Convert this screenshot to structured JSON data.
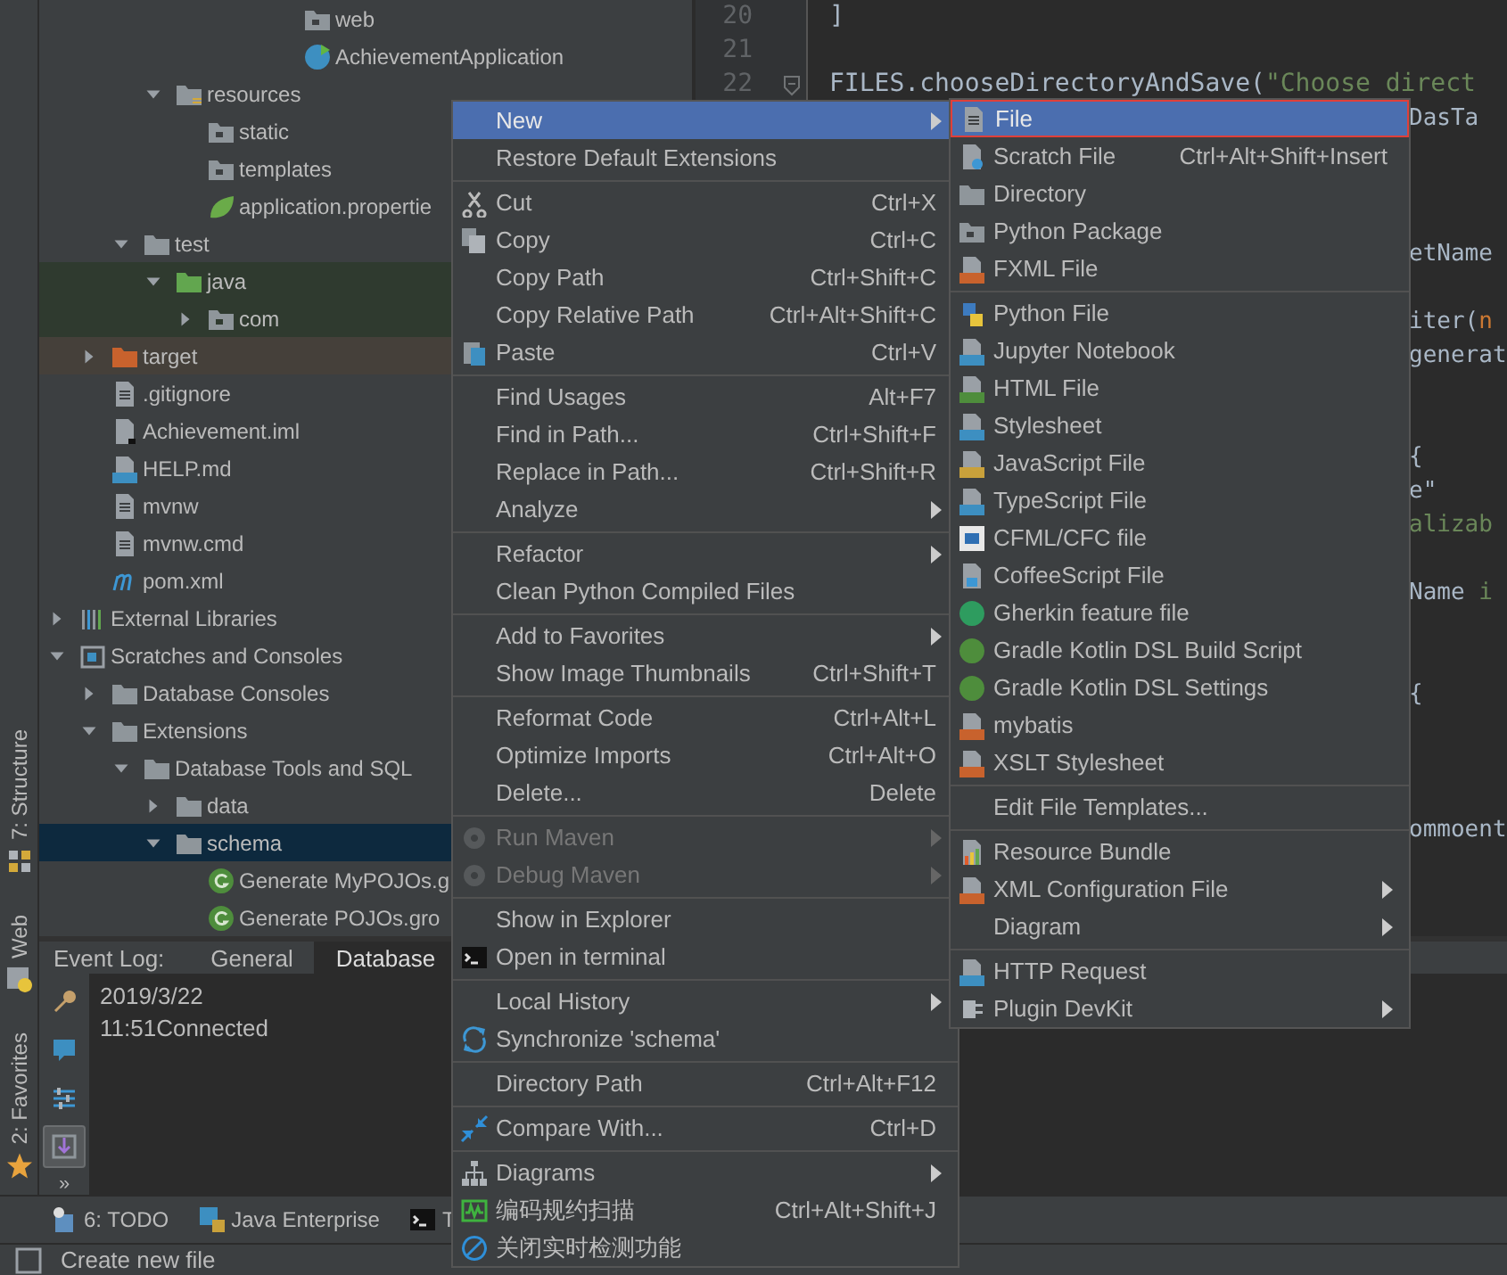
{
  "side_strip": {
    "tabs": [
      {
        "label": "7: Structure",
        "kind": "structure"
      },
      {
        "label": "Web",
        "kind": "web"
      },
      {
        "label": "2: Favorites",
        "kind": "star"
      }
    ]
  },
  "project_tree": {
    "items": [
      {
        "children": [
          {
            "children": [
              {
                "children": [
                  {
                    "children": [
                      {
                        "children": [
                          {
                            "children": [
                              {
                                "children": [
                                  {
                                    "label": "web",
                                    "kind": "package",
                                    "selected": false
                                  },
                                  {
                                    "label": "AchievementApplication",
                                    "kind": "spring-class",
                                    "selected": false
                                  }
                                ]
                              }
                            ]
                          }
                        ]
                      }
                    ]
                  },
                  {
                    "label": "resources",
                    "kind": "resource-folder",
                    "expanded": true,
                    "selected": false,
                    "children": [
                      {
                        "label": "static",
                        "kind": "package",
                        "selected": false
                      },
                      {
                        "label": "templates",
                        "kind": "package",
                        "selected": false
                      },
                      {
                        "label": "application.propertie",
                        "kind": "spring",
                        "selected": false
                      }
                    ]
                  }
                ]
              },
              {
                "label": "test",
                "kind": "folder",
                "expanded": true,
                "selected": false,
                "children": [
                  {
                    "label": "java",
                    "kind": "test-folder",
                    "expanded": true,
                    "selected": false,
                    "children": [
                      {
                        "label": "com",
                        "kind": "test-package",
                        "expanded": false,
                        "selected": false
                      }
                    ]
                  }
                ]
              }
            ]
          },
          {
            "label": "target",
            "kind": "excluded-folder",
            "expanded": false,
            "selected": false
          },
          {
            "label": ".gitignore",
            "kind": "text-file",
            "selected": false
          },
          {
            "label": "Achievement.iml",
            "kind": "iml",
            "selected": false
          },
          {
            "label": "HELP.md",
            "kind": "md",
            "selected": false
          },
          {
            "label": "mvnw",
            "kind": "text-file",
            "selected": false
          },
          {
            "label": "mvnw.cmd",
            "kind": "text-file",
            "selected": false
          },
          {
            "label": "pom.xml",
            "kind": "maven",
            "selected": false
          }
        ]
      },
      {
        "label": "External Libraries",
        "kind": "libraries",
        "expanded": false,
        "selected": false
      },
      {
        "label": "Scratches and Consoles",
        "kind": "scratches",
        "expanded": true,
        "selected": false,
        "children": [
          {
            "label": "Database Consoles",
            "kind": "folder",
            "expanded": false,
            "selected": false
          },
          {
            "label": "Extensions",
            "kind": "folder",
            "expanded": true,
            "selected": false,
            "children": [
              {
                "label": "Database Tools and SQL",
                "kind": "folder",
                "expanded": true,
                "selected": false,
                "children": [
                  {
                    "label": "data",
                    "kind": "folder",
                    "expanded": false,
                    "selected": false
                  },
                  {
                    "label": "schema",
                    "kind": "folder",
                    "expanded": true,
                    "selected": true,
                    "children": [
                      {
                        "label": "Generate MyPOJOs.g",
                        "kind": "groovy",
                        "selected": false
                      },
                      {
                        "label": "Generate POJOs.gro",
                        "kind": "groovy",
                        "selected": false
                      }
                    ]
                  }
                ]
              }
            ]
          }
        ]
      }
    ]
  },
  "editor": {
    "lines": [
      {
        "number": "20",
        "fold": false,
        "segments": [
          {
            "text": "]",
            "kind": "plain"
          }
        ]
      },
      {
        "number": "21",
        "fold": false
      },
      {
        "number": "22",
        "fold": true,
        "segments": [
          {
            "text": "FILES.chooseDirectoryAndSave(",
            "kind": "plain"
          },
          {
            "text": "\"Choose direct",
            "kind": "string"
          }
        ]
      }
    ],
    "peek": [
      {
        "segments": [
          {
            "text": "DasTa",
            "kind": "plain"
          }
        ]
      },
      {
        "segments": [
          {
            "text": "etName",
            "kind": "plain"
          }
        ]
      },
      {
        "segments": [
          {
            "text": "iter(",
            "kind": "plain"
          },
          {
            "text": "n",
            "kind": "keyword"
          }
        ]
      },
      {
        "segments": [
          {
            "text": "generat",
            "kind": "plain"
          }
        ]
      },
      {
        "segments": [
          {
            "text": "{",
            "kind": "plain"
          }
        ]
      },
      {
        "segments": [
          {
            "text": "e\"",
            "kind": "plain"
          }
        ]
      },
      {
        "segments": [
          {
            "text": "alizab",
            "kind": "string"
          }
        ]
      },
      {
        "segments": [
          {
            "text": "Name ",
            "kind": "plain"
          },
          {
            "text": "i",
            "kind": "string"
          }
        ]
      },
      {
        "segments": [
          {
            "text": "{",
            "kind": "plain"
          }
        ]
      },
      {
        "segments": [
          {
            "text": "ommoent",
            "kind": "plain"
          }
        ]
      }
    ]
  },
  "event_log": {
    "title": "Event Log:",
    "tabs": [
      {
        "label": "General",
        "selected": false
      },
      {
        "label": "Database",
        "selected": true
      }
    ],
    "tools": [
      {
        "kind": "wrench",
        "on": false
      },
      {
        "kind": "balloon",
        "on": false
      },
      {
        "kind": "sliders",
        "on": false
      },
      {
        "kind": "scroll",
        "on": true
      }
    ],
    "more": "»",
    "entries": [
      {
        "date": "2019/3/22",
        "time": "11:51",
        "message": "Connected"
      }
    ]
  },
  "bottom_toolbar": [
    {
      "label": "6: TODO",
      "kind": "todo"
    },
    {
      "label": "Java Enterprise",
      "kind": "java-ee"
    },
    {
      "label": "T",
      "kind": "terminal"
    }
  ],
  "status_bar": {
    "text": "Create new file"
  },
  "context_menu": {
    "groups": [
      [
        {
          "label": "New",
          "kind": "plain",
          "submenu": true,
          "selected": true,
          "disabled": false
        },
        {
          "label": "Restore Default Extensions",
          "kind": "plain",
          "submenu": false,
          "selected": false,
          "disabled": false
        }
      ],
      [
        {
          "label": "Cut",
          "kind": "scissors",
          "shortcut": "Ctrl+X",
          "submenu": false,
          "selected": false,
          "disabled": false
        },
        {
          "label": "Copy",
          "kind": "copy",
          "shortcut": "Ctrl+C",
          "submenu": false,
          "selected": false,
          "disabled": false
        },
        {
          "label": "Copy Path",
          "kind": "plain",
          "shortcut": "Ctrl+Shift+C",
          "submenu": false,
          "selected": false,
          "disabled": false
        },
        {
          "label": "Copy Relative Path",
          "kind": "plain",
          "shortcut": "Ctrl+Alt+Shift+C",
          "submenu": false,
          "selected": false,
          "disabled": false
        },
        {
          "label": "Paste",
          "kind": "paste",
          "shortcut": "Ctrl+V",
          "submenu": false,
          "selected": false,
          "disabled": false
        }
      ],
      [
        {
          "label": "Find Usages",
          "kind": "plain",
          "shortcut": "Alt+F7",
          "submenu": false,
          "selected": false,
          "disabled": false
        },
        {
          "label": "Find in Path...",
          "kind": "plain",
          "shortcut": "Ctrl+Shift+F",
          "submenu": false,
          "selected": false,
          "disabled": false
        },
        {
          "label": "Replace in Path...",
          "kind": "plain",
          "shortcut": "Ctrl+Shift+R",
          "submenu": false,
          "selected": false,
          "disabled": false
        },
        {
          "label": "Analyze",
          "kind": "plain",
          "submenu": true,
          "selected": false,
          "disabled": false
        }
      ],
      [
        {
          "label": "Refactor",
          "kind": "plain",
          "submenu": true,
          "selected": false,
          "disabled": false
        },
        {
          "label": "Clean Python Compiled Files",
          "kind": "plain",
          "submenu": false,
          "selected": false,
          "disabled": false
        }
      ],
      [
        {
          "label": "Add to Favorites",
          "kind": "plain",
          "submenu": true,
          "selected": false,
          "disabled": false
        },
        {
          "label": "Show Image Thumbnails",
          "kind": "plain",
          "shortcut": "Ctrl+Shift+T",
          "submenu": false,
          "selected": false,
          "disabled": false
        }
      ],
      [
        {
          "label": "Reformat Code",
          "kind": "plain",
          "shortcut": "Ctrl+Alt+L",
          "submenu": false,
          "selected": false,
          "disabled": false
        },
        {
          "label": "Optimize Imports",
          "kind": "plain",
          "shortcut": "Ctrl+Alt+O",
          "submenu": false,
          "selected": false,
          "disabled": false
        },
        {
          "label": "Delete...",
          "kind": "plain",
          "shortcut": "Delete",
          "submenu": false,
          "selected": false,
          "disabled": false
        }
      ],
      [
        {
          "label": "Run Maven",
          "kind": "gear",
          "submenu": true,
          "selected": false,
          "disabled": true
        },
        {
          "label": "Debug Maven",
          "kind": "gear",
          "submenu": true,
          "selected": false,
          "disabled": true
        }
      ],
      [
        {
          "label": "Show in Explorer",
          "kind": "plain",
          "submenu": false,
          "selected": false,
          "disabled": false
        },
        {
          "label": "Open in terminal",
          "kind": "terminal",
          "submenu": false,
          "selected": false,
          "disabled": false
        }
      ],
      [
        {
          "label": "Local History",
          "kind": "plain",
          "submenu": true,
          "selected": false,
          "disabled": false
        },
        {
          "label": "Synchronize 'schema'",
          "kind": "sync",
          "submenu": false,
          "selected": false,
          "disabled": false
        }
      ],
      [
        {
          "label": "Directory Path",
          "kind": "plain",
          "shortcut": "Ctrl+Alt+F12",
          "submenu": false,
          "selected": false,
          "disabled": false
        }
      ],
      [
        {
          "label": "Compare With...",
          "kind": "compare",
          "shortcut": "Ctrl+D",
          "submenu": false,
          "selected": false,
          "disabled": false
        }
      ],
      [
        {
          "label": "Diagrams",
          "kind": "diagram",
          "submenu": true,
          "selected": false,
          "disabled": false
        },
        {
          "label": "编码规约扫描",
          "kind": "pulse",
          "shortcut": "Ctrl+Alt+Shift+J",
          "submenu": false,
          "selected": false,
          "disabled": false
        },
        {
          "label": "关闭实时检测功能",
          "kind": "forbid",
          "submenu": false,
          "selected": false,
          "disabled": false
        }
      ]
    ]
  },
  "new_submenu": {
    "groups": [
      [
        {
          "label": "File",
          "kind": "text-file",
          "submenu": false,
          "selected": true,
          "outlined": true
        },
        {
          "label": "Scratch File",
          "kind": "scratch-file",
          "shortcut": "Ctrl+Alt+Shift+Insert",
          "submenu": false,
          "selected": false,
          "outlined": false
        },
        {
          "label": "Directory",
          "kind": "folder",
          "submenu": false,
          "selected": false,
          "outlined": false
        },
        {
          "label": "Python Package",
          "kind": "package",
          "submenu": false,
          "selected": false,
          "outlined": false
        },
        {
          "label": "FXML File",
          "kind": "xml",
          "submenu": false,
          "selected": false,
          "outlined": false
        }
      ],
      [
        {
          "label": "Python File",
          "kind": "python",
          "submenu": false,
          "selected": false,
          "outlined": false
        },
        {
          "label": "Jupyter Notebook",
          "kind": "jupyter",
          "submenu": false,
          "selected": false,
          "outlined": false
        },
        {
          "label": "HTML File",
          "kind": "html",
          "submenu": false,
          "selected": false,
          "outlined": false
        },
        {
          "label": "Stylesheet",
          "kind": "css",
          "submenu": false,
          "selected": false,
          "outlined": false
        },
        {
          "label": "JavaScript File",
          "kind": "js",
          "submenu": false,
          "selected": false,
          "outlined": false
        },
        {
          "label": "TypeScript File",
          "kind": "ts",
          "submenu": false,
          "selected": false,
          "outlined": false
        },
        {
          "label": "CFML/CFC file",
          "kind": "cf",
          "submenu": false,
          "selected": false,
          "outlined": false
        },
        {
          "label": "CoffeeScript File",
          "kind": "coffee",
          "submenu": false,
          "selected": false,
          "outlined": false
        },
        {
          "label": "Gherkin feature file",
          "kind": "gherkin",
          "submenu": false,
          "selected": false,
          "outlined": false
        },
        {
          "label": "Gradle Kotlin DSL Build Script",
          "kind": "gradle",
          "submenu": false,
          "selected": false,
          "outlined": false
        },
        {
          "label": "Gradle Kotlin DSL Settings",
          "kind": "gradle",
          "submenu": false,
          "selected": false,
          "outlined": false
        },
        {
          "label": "mybatis",
          "kind": "xml",
          "submenu": false,
          "selected": false,
          "outlined": false
        },
        {
          "label": "XSLT Stylesheet",
          "kind": "xml",
          "submenu": false,
          "selected": false,
          "outlined": false
        }
      ],
      [
        {
          "label": "Edit File Templates...",
          "kind": "plain",
          "submenu": false,
          "selected": false,
          "outlined": false
        }
      ],
      [
        {
          "label": "Resource Bundle",
          "kind": "bundle",
          "submenu": false,
          "selected": false,
          "outlined": false
        },
        {
          "label": "XML Configuration File",
          "kind": "xml",
          "submenu": true,
          "selected": false,
          "outlined": false
        },
        {
          "label": "Diagram",
          "kind": "plain",
          "submenu": true,
          "selected": false,
          "outlined": false
        }
      ],
      [
        {
          "label": "HTTP Request",
          "kind": "api",
          "submenu": false,
          "selected": false,
          "outlined": false
        },
        {
          "label": "Plugin DevKit",
          "kind": "plugin",
          "submenu": true,
          "selected": false,
          "outlined": false
        }
      ]
    ]
  }
}
